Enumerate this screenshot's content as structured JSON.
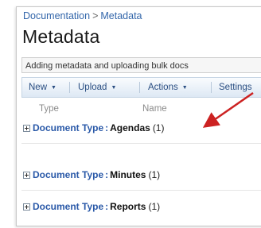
{
  "breadcrumb": {
    "parent": "Documentation",
    "separator": ">",
    "current": "Metadata"
  },
  "page_title": "Metadata",
  "description": "Adding metadata and uploading bulk docs",
  "toolbar": {
    "new_label": "New",
    "upload_label": "Upload",
    "actions_label": "Actions",
    "settings_label": "Settings"
  },
  "columns": {
    "type": "Type",
    "name": "Name"
  },
  "groups": [
    {
      "field": "Document Type",
      "separator": ":",
      "value": "Agendas",
      "count": "(1)"
    },
    {
      "field": "Document Type",
      "separator": ":",
      "value": "Minutes",
      "count": "(1)"
    },
    {
      "field": "Document Type",
      "separator": ":",
      "value": "Reports",
      "count": "(1)"
    }
  ],
  "colors": {
    "link": "#3366aa",
    "group_field": "#2a59a8",
    "annotation_arrow": "#cc2222"
  }
}
